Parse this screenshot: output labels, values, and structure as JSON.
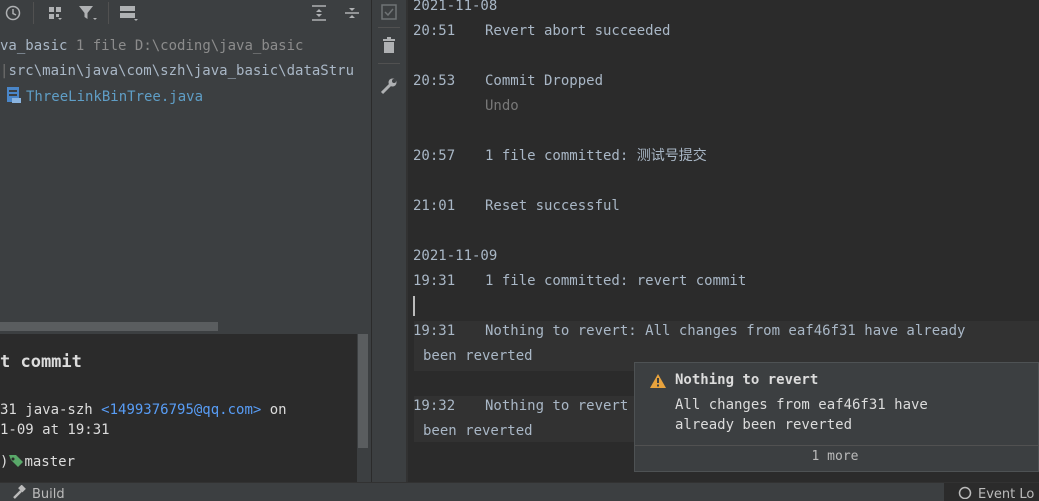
{
  "changes_panel": {
    "toolbar_icons": [
      "history-icon",
      "group-by-icon",
      "filter-icon",
      "layout-icon",
      "expand-all-icon",
      "collapse-all-icon"
    ],
    "repo_name": "va_basic",
    "repo_count": "1 file",
    "repo_path": "D:\\coding\\java_basic",
    "path_row": "src\\main\\java\\com\\szh\\java_basic\\dataStru",
    "file_name": "ThreeLinkBinTree.java"
  },
  "commit_details": {
    "title": "t commit",
    "author_line_prefix": "31 java-szh",
    "email": "<1499376795@qq.com>",
    "author_line_suffix": "on",
    "date_line": "1-09 at 19:31",
    "branch_prefix": ")",
    "branch": "master"
  },
  "side_tools": [
    "commit-check-icon",
    "trash-icon",
    "wrench-icon"
  ],
  "event_log": {
    "entries": [
      {
        "date": "2021-11-08"
      },
      {
        "time": "20:51",
        "text": "Revert abort succeeded"
      },
      {
        "time": "20:53",
        "text": "Commit Dropped",
        "link": "Undo"
      },
      {
        "time": "20:57",
        "text": "1 file committed: 测试号提交"
      },
      {
        "time": "21:01",
        "text": "Reset successful"
      },
      {
        "date": "2021-11-09"
      },
      {
        "time": "19:31",
        "text": "1 file committed: revert commit"
      },
      {
        "time": "19:31",
        "text": "Nothing to revert: All changes from eaf46f31 have already",
        "continuation": "been reverted"
      },
      {
        "time": "19:32",
        "text": "Nothing to revert",
        "continuation": "been reverted"
      }
    ]
  },
  "notification": {
    "title": "Nothing to revert",
    "body_line1": "All changes from eaf46f31 have",
    "body_line2": "already been reverted",
    "more": "1 more",
    "warning_color": "#e8a33d"
  },
  "status_bar": {
    "build_label": "Build",
    "event_log_label": "Event Lo"
  },
  "colors": {
    "link_blue": "#589df6",
    "file_blue": "#5f9ec6",
    "tag_green": "#59a869"
  }
}
